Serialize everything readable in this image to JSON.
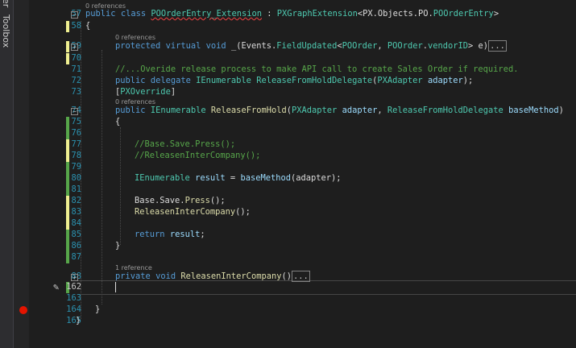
{
  "side": {
    "label_top": "er",
    "label_toolbox": "Toolbox"
  },
  "refs": {
    "r0": "0 references",
    "r1": "0 references",
    "r2": "0 references",
    "r3": "1 reference"
  },
  "lines": {
    "l57": {
      "num": "57",
      "t1": "public",
      "t2": "class",
      "t3": "POOrderEntry_Extension",
      "t4": ":",
      "t5": "PXGraphExtension",
      "t6": "<PX.Objects.PO.",
      "t7": "POOrderEntry",
      "t8": ">"
    },
    "l58": {
      "num": "58",
      "t1": "{"
    },
    "l59": {
      "num": "59",
      "t1": "protected",
      "t2": "virtual",
      "t3": "void",
      "t4": "_(Events.",
      "t5": "FieldUpdated",
      "t6": "<",
      "t7": "POOrder",
      "t8": ",",
      "t9": "POOrder",
      "t10": ".",
      "t11": "vendorID",
      "t12": "> e)",
      "t13": "..."
    },
    "l70": {
      "num": "70"
    },
    "l71": {
      "num": "71",
      "t1": "//...Overide release process to make API call to create Sales Order if required."
    },
    "l72": {
      "num": "72",
      "t1": "public",
      "t2": "delegate",
      "t3": "IEnumerable",
      "t4": "ReleaseFromHoldDelegate",
      "t5": "(",
      "t6": "PXAdapter",
      "t7": "adapter",
      "t8": ");"
    },
    "l73": {
      "num": "73",
      "t1": "[",
      "t2": "PXOverride",
      "t3": "]"
    },
    "l74": {
      "num": "74",
      "t1": "public",
      "t2": "IEnumerable",
      "t3": "ReleaseFromHold",
      "t4": "(",
      "t5": "PXAdapter",
      "t6": "adapter",
      "t7": ",",
      "t8": "ReleaseFromHoldDelegate",
      "t9": "baseMethod",
      "t10": ")"
    },
    "l75": {
      "num": "75",
      "t1": "{"
    },
    "l76": {
      "num": "76"
    },
    "l77": {
      "num": "77",
      "t1": "//Base.Save.Press();"
    },
    "l78": {
      "num": "78",
      "t1": "//ReleasenInterCompany();"
    },
    "l79": {
      "num": "79"
    },
    "l80": {
      "num": "80",
      "t1": "IEnumerable",
      "t2": "result",
      "t3": "=",
      "t4": "baseMethod",
      "t5": "(adapter);"
    },
    "l81": {
      "num": "81"
    },
    "l82": {
      "num": "82",
      "t1": "Base.Save.",
      "t2": "Press",
      "t3": "();"
    },
    "l83": {
      "num": "83",
      "t1": "ReleasenInterCompany",
      "t2": "();"
    },
    "l84": {
      "num": "84"
    },
    "l85": {
      "num": "85",
      "t1": "return",
      "t2": "result",
      "t3": ";"
    },
    "l86": {
      "num": "86",
      "t1": "}"
    },
    "l87": {
      "num": "87"
    },
    "l88": {
      "num": "88",
      "t1": "private",
      "t2": "void",
      "t3": "ReleasenInterCompany",
      "t4": "()",
      "t5": "..."
    },
    "l162": {
      "num": "162"
    },
    "l163": {
      "num": "163"
    },
    "l164": {
      "num": "164",
      "t1": "}"
    },
    "l165": {
      "num": "165",
      "t1": "}"
    }
  },
  "colors": {
    "keyword": "#569cd6",
    "type": "#4ec9b0",
    "comment": "#57a64a",
    "method": "#dcdcaa",
    "param": "#9cdcfe",
    "line_number": "#2b91af",
    "breakpoint": "#e51400",
    "change_saved": "#57a64a",
    "change_unsaved": "#efef91"
  }
}
